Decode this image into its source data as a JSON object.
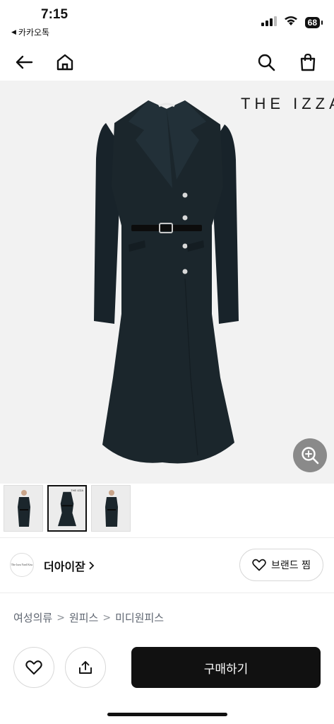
{
  "status_bar": {
    "time": "7:15",
    "back_app": "카카오톡",
    "battery": "68"
  },
  "nav": {
    "icons": [
      "arrow-left-icon",
      "home-icon",
      "search-icon",
      "shopping-bag-icon"
    ]
  },
  "product": {
    "watermark": "THE IZZA",
    "thumbnails_label": "THE IZZA"
  },
  "brand": {
    "logo_text": "The Izza Yard Kiss",
    "name": "더아이잗",
    "like_label": "브랜드 찜"
  },
  "breadcrumb": [
    "여성의류",
    "원피스",
    "미디원피스"
  ],
  "bottom": {
    "buy_label": "구매하기"
  },
  "colors": {
    "buy_button": "#111111",
    "image_bg": "#f2f2f2",
    "dress": "#1b262c"
  }
}
